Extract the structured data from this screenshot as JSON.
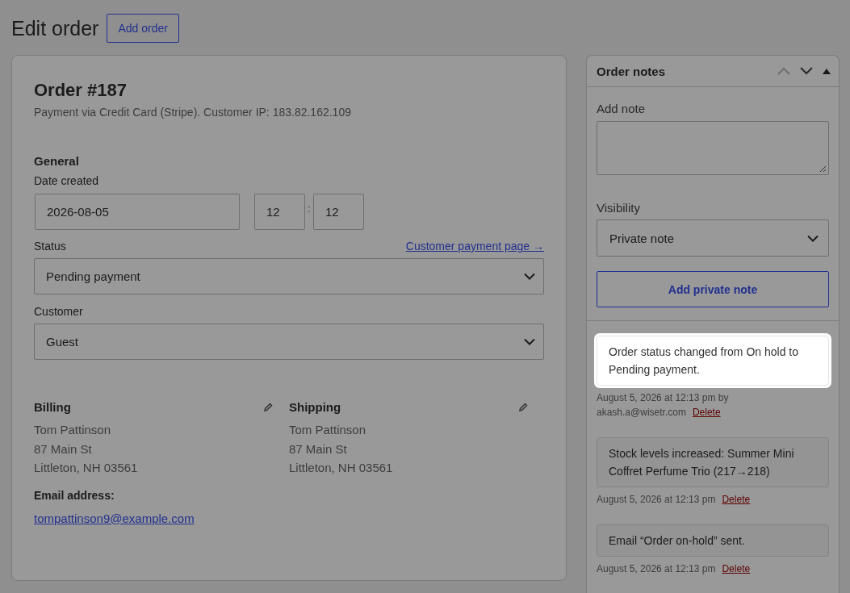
{
  "page": {
    "title": "Edit order",
    "add_button": "Add order"
  },
  "order": {
    "title": "Order #187",
    "subtitle": "Payment via Credit Card (Stripe). Customer IP: 183.82.162.109",
    "general": {
      "heading": "General",
      "date_label": "Date created",
      "date": "2026-08-05",
      "hour": "12",
      "separator": ":",
      "minute": "12",
      "status_label": "Status",
      "payment_link": "Customer payment page →",
      "status": "Pending payment",
      "customer_label": "Customer",
      "customer": "Guest"
    },
    "addresses": [
      {
        "heading": "Billing",
        "lines": [
          "Tom Pattinson",
          "87 Main St",
          "Littleton, NH 03561"
        ]
      },
      {
        "heading": "Shipping",
        "lines": [
          "Tom Pattinson",
          "87 Main St",
          "Littleton, NH 03561"
        ]
      }
    ],
    "email_label": "Email address:",
    "email": "tompattinson9@example.com"
  },
  "notes_panel": {
    "title": "Order notes",
    "add_note_label": "Add note",
    "visibility_label": "Visibility",
    "visibility": "Private note",
    "add_button": "Add private note",
    "notes": [
      {
        "text": "Order status changed from On hold to Pending payment.",
        "meta": "August 5, 2026 at 12:13 pm by",
        "author": "akash.a@wisetr.com",
        "delete": "Delete",
        "highlighted": true
      },
      {
        "text": "Stock levels increased: Summer Mini Coffret Perfume Trio (217→218)",
        "meta": "August 5, 2026 at 12:13 pm",
        "delete": "Delete",
        "highlighted": false
      },
      {
        "text": "Email “Order on-hold” sent.",
        "meta": "August 5, 2026 at 12:13 pm",
        "delete": "Delete",
        "highlighted": false
      }
    ]
  }
}
